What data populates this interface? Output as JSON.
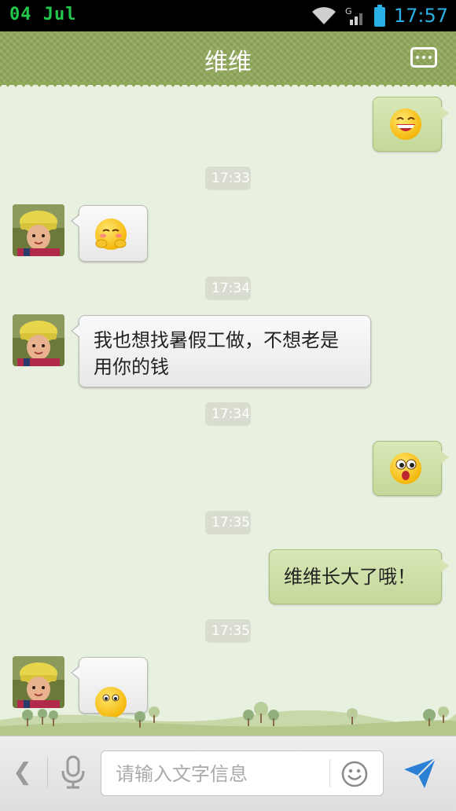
{
  "status_bar": {
    "date": "04  Jul",
    "time": "17:57"
  },
  "header": {
    "title": "维维",
    "menu_icon": "more-icon"
  },
  "messages": [
    {
      "type": "outgoing",
      "kind": "emoji",
      "emoji": "grin-emoji"
    },
    {
      "type": "timestamp",
      "text": "17:33"
    },
    {
      "type": "incoming",
      "kind": "emoji",
      "emoji": "shy-emoji"
    },
    {
      "type": "timestamp",
      "text": "17:34"
    },
    {
      "type": "incoming",
      "kind": "text",
      "text": "我也想找暑假工做，不想老是用你的钱"
    },
    {
      "type": "timestamp",
      "text": "17:34"
    },
    {
      "type": "outgoing",
      "kind": "emoji",
      "emoji": "surprised-emoji"
    },
    {
      "type": "timestamp",
      "text": "17:35"
    },
    {
      "type": "outgoing",
      "kind": "text",
      "text": "维维长大了哦！"
    },
    {
      "type": "timestamp",
      "text": "17:35"
    },
    {
      "type": "incoming",
      "kind": "emoji",
      "emoji": "peek-emoji"
    }
  ],
  "input_bar": {
    "placeholder": "请输入文字信息",
    "value": ""
  },
  "colors": {
    "header": "#8fa85a",
    "chat_bg": "#e8f0df",
    "outgoing_bubble": "#cfe0a8",
    "incoming_bubble": "#f4f4f4",
    "accent": "#2b7fd4"
  }
}
